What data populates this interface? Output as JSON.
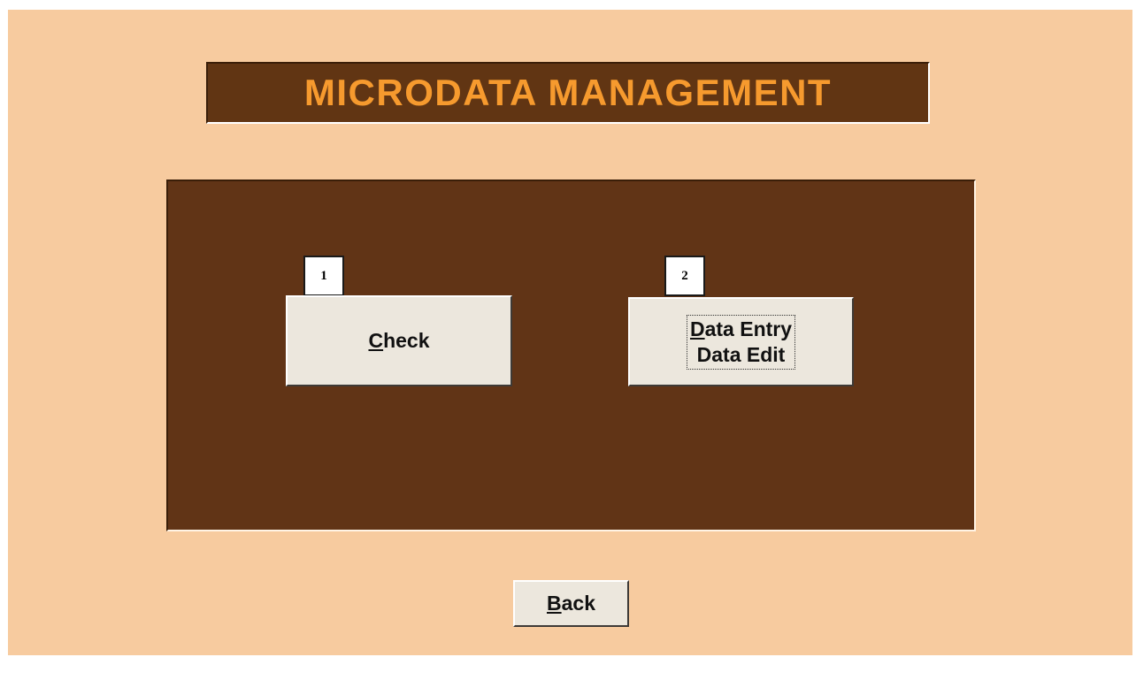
{
  "form": {
    "title": "MICRODATA MANAGEMENT",
    "colors": {
      "background": "#f7cb9f",
      "title_bg": "#613513",
      "title_text": "#f69a2e",
      "panel_bg": "#613416",
      "button_face": "#ece7dd"
    }
  },
  "badges": {
    "badge_1": "1",
    "badge_2": "2"
  },
  "buttons": {
    "check": {
      "accel": "C",
      "rest": "heck"
    },
    "data_entry": {
      "line1_accel": "D",
      "line1_rest": "ata Entry",
      "line2": "Data Edit"
    },
    "back": {
      "accel": "B",
      "rest": "ack"
    }
  }
}
